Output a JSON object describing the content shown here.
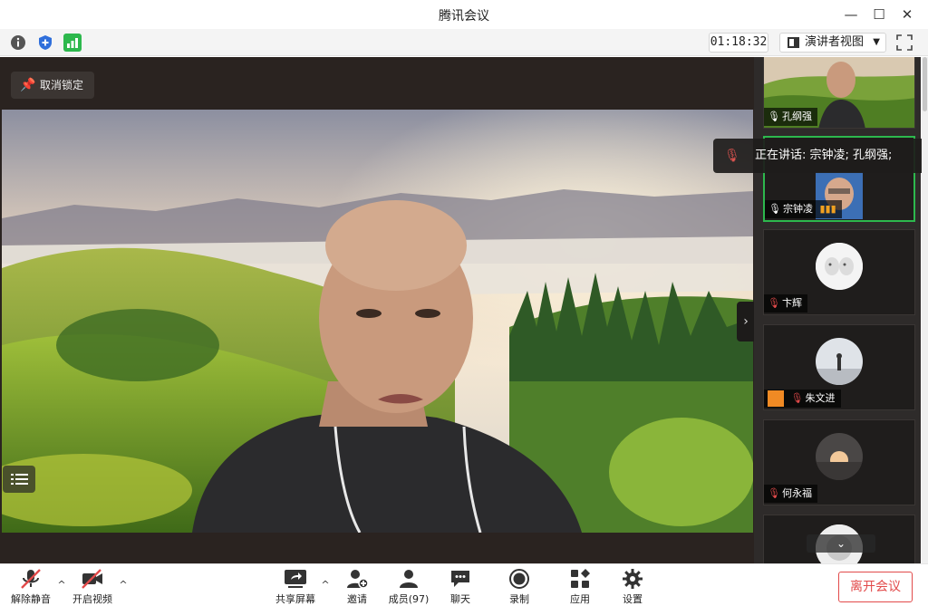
{
  "window": {
    "title": "腾讯会议"
  },
  "infobar": {
    "timer": "01:18:32",
    "view_mode": "演讲者视图"
  },
  "stage": {
    "unpin_label": "取消锁定"
  },
  "speaking_banner": "正在讲话: 宗钟凌; 孔纲强;",
  "participants": [
    {
      "name": "孔纲强",
      "mic": "on"
    },
    {
      "name": "宗钟凌",
      "mic": "on"
    },
    {
      "name": "卞辉",
      "mic": "muted"
    },
    {
      "name": "朱文进",
      "mic": "muted"
    },
    {
      "name": "何永福",
      "mic": "muted"
    }
  ],
  "toolbar": {
    "unmute": "解除静音",
    "start_video": "开启视频",
    "share_screen": "共享屏幕",
    "invite": "邀请",
    "members": "成员(97)",
    "chat": "聊天",
    "record": "录制",
    "apps": "应用",
    "settings": "设置",
    "leave": "离开会议"
  },
  "colors": {
    "leave_red": "#e24a4a",
    "active_green": "#2db84d",
    "signal_green": "#2db84d",
    "shield_blue": "#2f6fdb"
  }
}
